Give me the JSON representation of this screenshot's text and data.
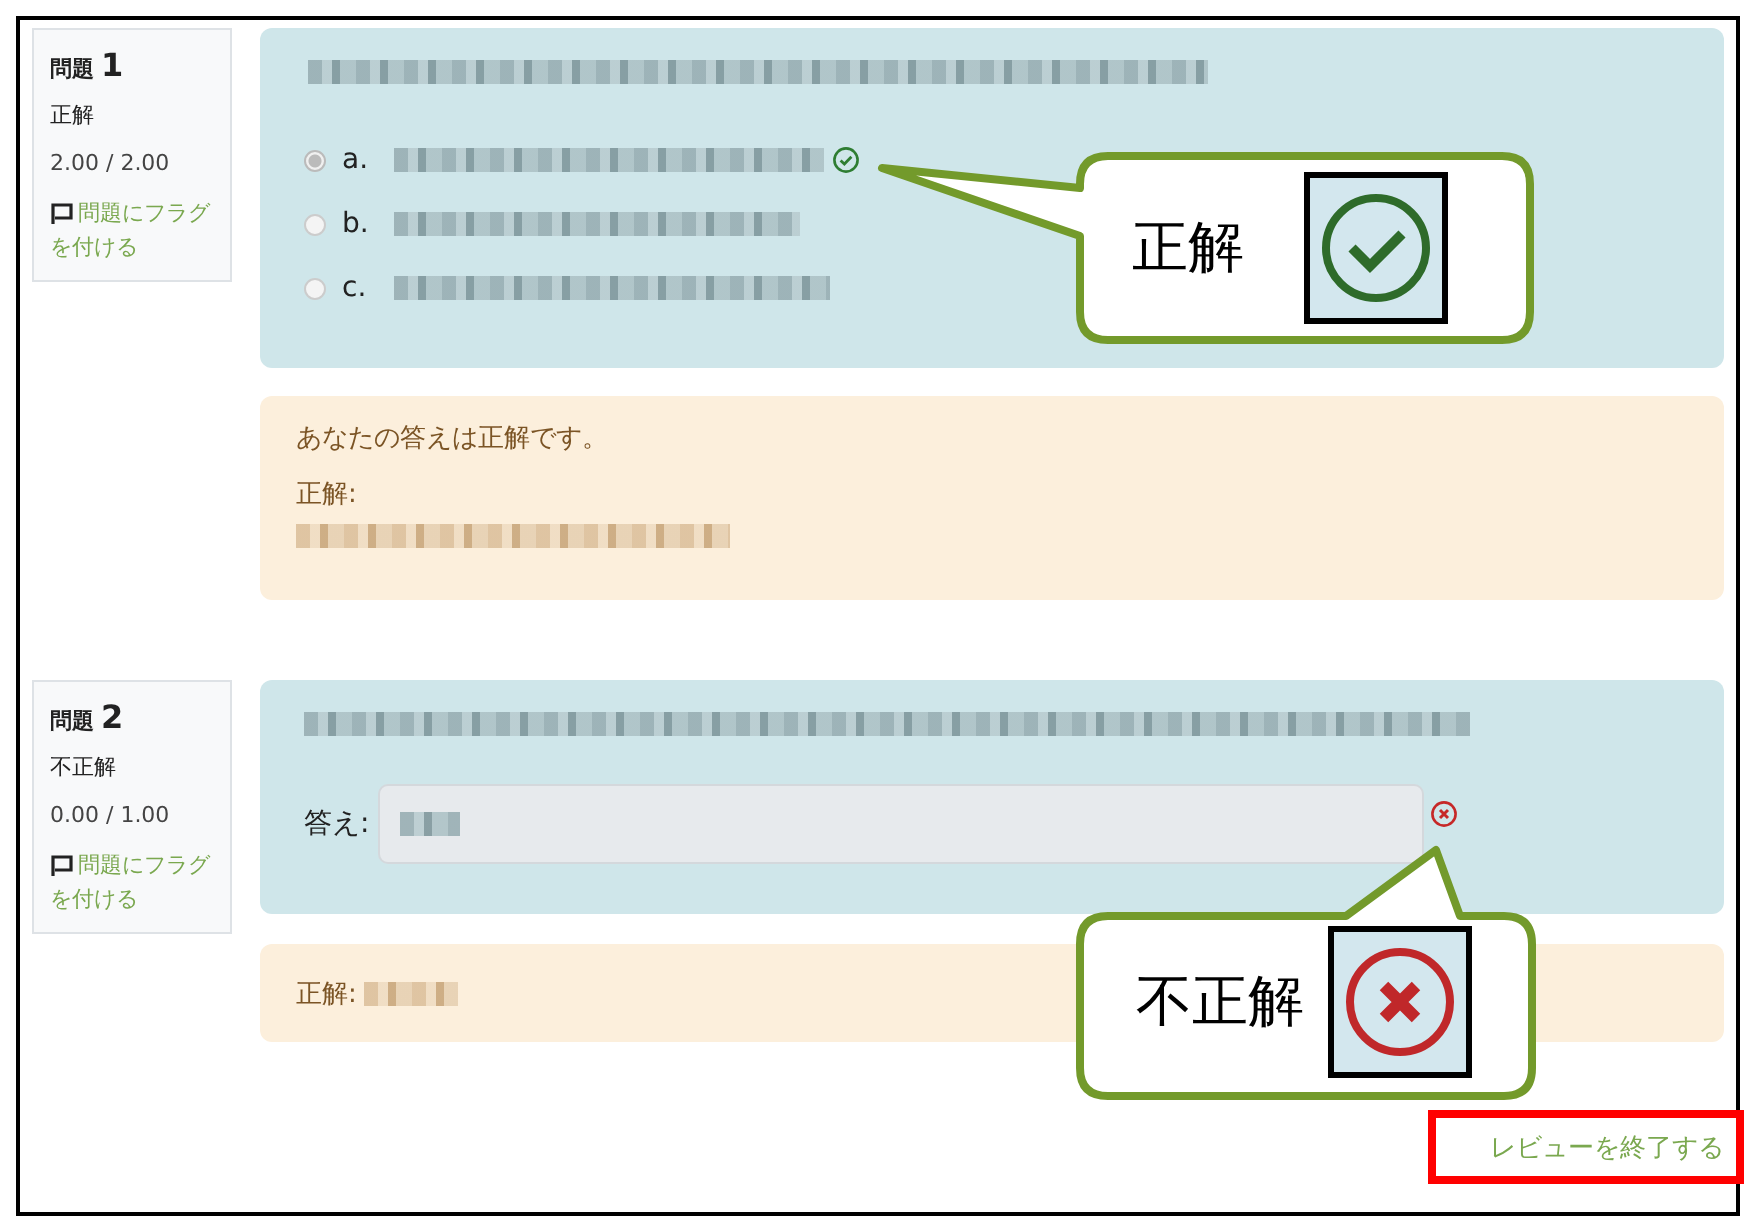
{
  "questions": [
    {
      "number_label": "問題",
      "number": "1",
      "status": "正解",
      "score": "2.00 / 2.00",
      "flag_link": "問題にフラグを付ける",
      "kind": "multichoice",
      "options": [
        {
          "letter": "a.",
          "selected": true,
          "correct": true
        },
        {
          "letter": "b.",
          "selected": false,
          "correct": false
        },
        {
          "letter": "c.",
          "selected": false,
          "correct": false
        }
      ],
      "feedback": {
        "message": "あなたの答えは正解です。",
        "answer_label": "正解:"
      }
    },
    {
      "number_label": "問題",
      "number": "2",
      "status": "不正解",
      "answer_correct": false,
      "score": "0.00 / 1.00",
      "flag_link": "問題にフラグを付ける",
      "kind": "shortanswer",
      "answer_label": "答え:",
      "feedback": {
        "answer_label": "正解:"
      }
    }
  ],
  "callouts": [
    {
      "text": "正解",
      "kind": "correct"
    },
    {
      "text": "不正解",
      "kind": "incorrect"
    }
  ],
  "finish_link": "レビューを終了する"
}
